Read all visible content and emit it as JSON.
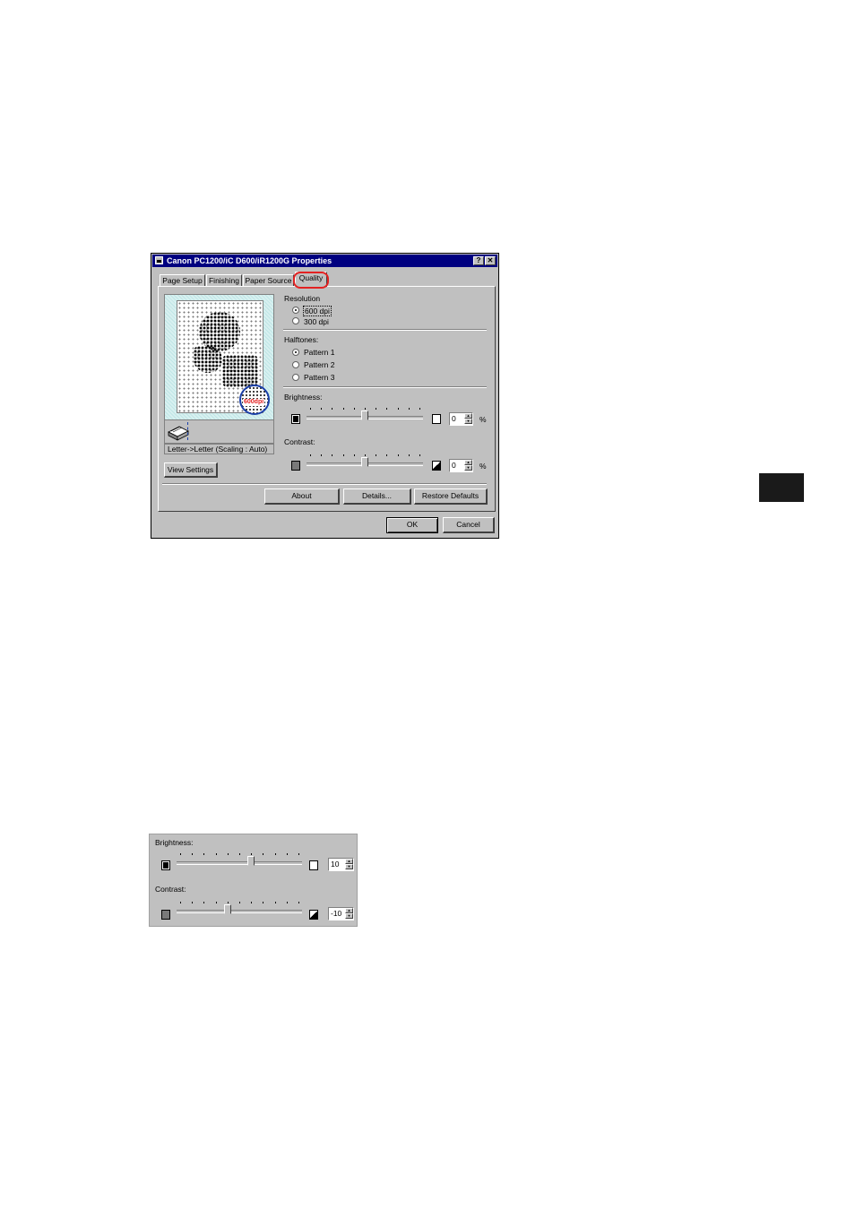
{
  "dialog": {
    "title": "Canon PC1200/iC D600/iR1200G Properties",
    "help_button": "?",
    "close_button": "✕",
    "tabs": [
      {
        "label": "Page Setup",
        "active": false
      },
      {
        "label": "Finishing",
        "active": false
      },
      {
        "label": "Paper Source",
        "active": false
      },
      {
        "label": "Quality",
        "active": true
      }
    ],
    "preview": {
      "badge": "600dpi",
      "caption": "Letter->Letter (Scaling : Auto)",
      "view_settings_label": "View Settings"
    },
    "resolution": {
      "label": "Resolution",
      "options": [
        {
          "label": "600 dpi",
          "selected": true
        },
        {
          "label": "300 dpi",
          "selected": false
        }
      ]
    },
    "halftones": {
      "label": "Halftones:",
      "options": [
        {
          "label": "Pattern 1",
          "selected": true
        },
        {
          "label": "Pattern 2",
          "selected": false
        },
        {
          "label": "Pattern 3",
          "selected": false
        }
      ]
    },
    "brightness": {
      "label": "Brightness:",
      "value": "0",
      "unit": "%",
      "slider_level": 0.5
    },
    "contrast": {
      "label": "Contrast:",
      "value": "0",
      "unit": "%",
      "slider_level": 0.5
    },
    "buttons": {
      "about": "About",
      "details": "Details...",
      "restore_defaults": "Restore Defaults",
      "ok": "OK",
      "cancel": "Cancel"
    }
  },
  "detail_panel": {
    "brightness": {
      "label": "Brightness:",
      "value": "10",
      "slider_level": 0.6
    },
    "contrast": {
      "label": "Contrast:",
      "value": "-10",
      "slider_level": 0.4
    }
  }
}
